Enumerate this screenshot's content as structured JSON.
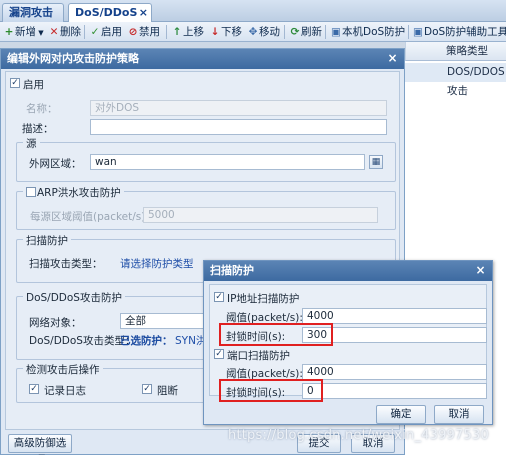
{
  "tabs": [
    {
      "label": "漏洞攻击防护"
    },
    {
      "label": "DoS/DDoS防护",
      "close": "×"
    }
  ],
  "toolbar": {
    "new": "新增",
    "delete": "删除",
    "enable": "启用",
    "disable": "禁用",
    "up": "上移",
    "down": "下移",
    "move": "移动",
    "refresh": "刷新",
    "local_dos": "本机DoS防护",
    "dos_tool": "DoS防护辅助工具"
  },
  "grid": {
    "header": "策略类型",
    "row1_type": "DOS/DDOS攻击"
  },
  "dialog": {
    "title": "编辑外网对内攻击防护策略",
    "close": "×",
    "enable_label": "启用",
    "name_label": "名称：",
    "name_value": "对外DOS",
    "desc_label": "描述：",
    "desc_value": "",
    "source": {
      "legend": "源",
      "zone_label": "外网区域：",
      "zone_value": "wan"
    },
    "arp": {
      "legend": "ARP洪水攻击防护",
      "threshold_label": "每源区域阈值(packet/s):",
      "threshold_value": "5000"
    },
    "scan_protect": {
      "legend": "扫描防护",
      "type_label": "扫描攻击类型：",
      "type_link": "请选择防护类型"
    },
    "dos": {
      "legend": "DoS/DDoS攻击防护",
      "target_label": "网络对象：",
      "target_value": "全部",
      "type_label": "DoS/DDoS攻击类型：",
      "selected_prefix": "已选防护：",
      "selected_value": "SYN洪水攻"
    },
    "action": {
      "legend": "检测攻击后操作",
      "log_label": "记录日志",
      "block_label": "阻断"
    },
    "advanced_button": "高级防御选项",
    "submit_button": "提交",
    "cancel_button": "取消"
  },
  "scan_dialog": {
    "title": "扫描防护",
    "close": "×",
    "ip_scan": {
      "label": "IP地址扫描防护",
      "threshold_label": "阈值(packet/s):",
      "threshold_value": "4000",
      "block_label": "封锁时间(s):",
      "block_value": "300"
    },
    "port_scan": {
      "label": "端口扫描防护",
      "threshold_label": "阈值(packet/s):",
      "threshold_value": "4000",
      "block_label": "封锁时间(s):",
      "block_value": "0"
    },
    "ok_button": "确定",
    "cancel_button": "取消"
  },
  "watermark": "https://blog.csdn.net/weixin_43997530",
  "colors": {
    "title_bar": "#3d6aa1",
    "link": "#1f4fa8",
    "highlight": "#e02020"
  }
}
